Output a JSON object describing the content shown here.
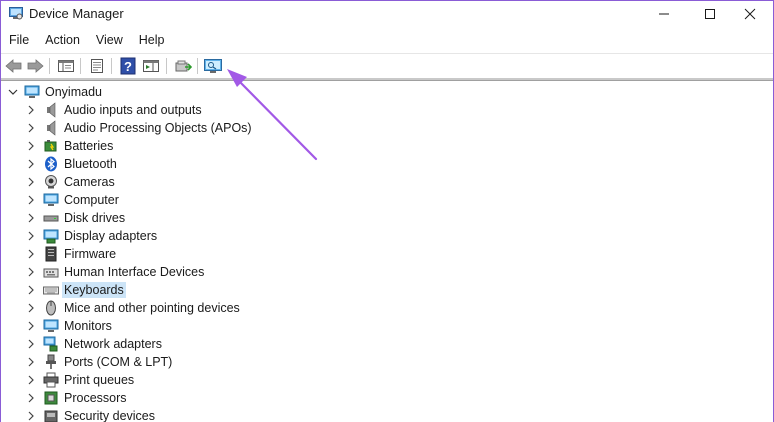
{
  "window": {
    "title": "Device Manager"
  },
  "menu": [
    "File",
    "Action",
    "View",
    "Help"
  ],
  "toolbar": {
    "buttons": [
      "back-arrow-icon",
      "forward-arrow-icon",
      "properties-console-icon",
      "properties-sheet-icon",
      "help-icon",
      "show-hide-pane-icon",
      "update-driver-icon",
      "scan-hardware-changes-icon"
    ]
  },
  "tree": {
    "root": "Onyimadu",
    "items": [
      {
        "label": "Audio inputs and outputs",
        "icon": "speaker-icon"
      },
      {
        "label": "Audio Processing Objects (APOs)",
        "icon": "speaker-icon"
      },
      {
        "label": "Batteries",
        "icon": "battery-icon"
      },
      {
        "label": "Bluetooth",
        "icon": "bluetooth-icon"
      },
      {
        "label": "Cameras",
        "icon": "camera-icon"
      },
      {
        "label": "Computer",
        "icon": "computer-icon"
      },
      {
        "label": "Disk drives",
        "icon": "disk-drive-icon"
      },
      {
        "label": "Display adapters",
        "icon": "display-adapter-icon"
      },
      {
        "label": "Firmware",
        "icon": "firmware-icon"
      },
      {
        "label": "Human Interface Devices",
        "icon": "hid-icon"
      },
      {
        "label": "Keyboards",
        "icon": "keyboard-icon",
        "selected": true
      },
      {
        "label": "Mice and other pointing devices",
        "icon": "mouse-icon"
      },
      {
        "label": "Monitors",
        "icon": "monitor-icon"
      },
      {
        "label": "Network adapters",
        "icon": "network-icon"
      },
      {
        "label": "Ports (COM & LPT)",
        "icon": "port-icon"
      },
      {
        "label": "Print queues",
        "icon": "printer-icon"
      },
      {
        "label": "Processors",
        "icon": "processor-icon"
      },
      {
        "label": "Security devices",
        "icon": "security-icon"
      }
    ]
  },
  "colors": {
    "arrow": "#a259e6",
    "selection": "#cce4f7",
    "frame": "#8a5cd6"
  }
}
